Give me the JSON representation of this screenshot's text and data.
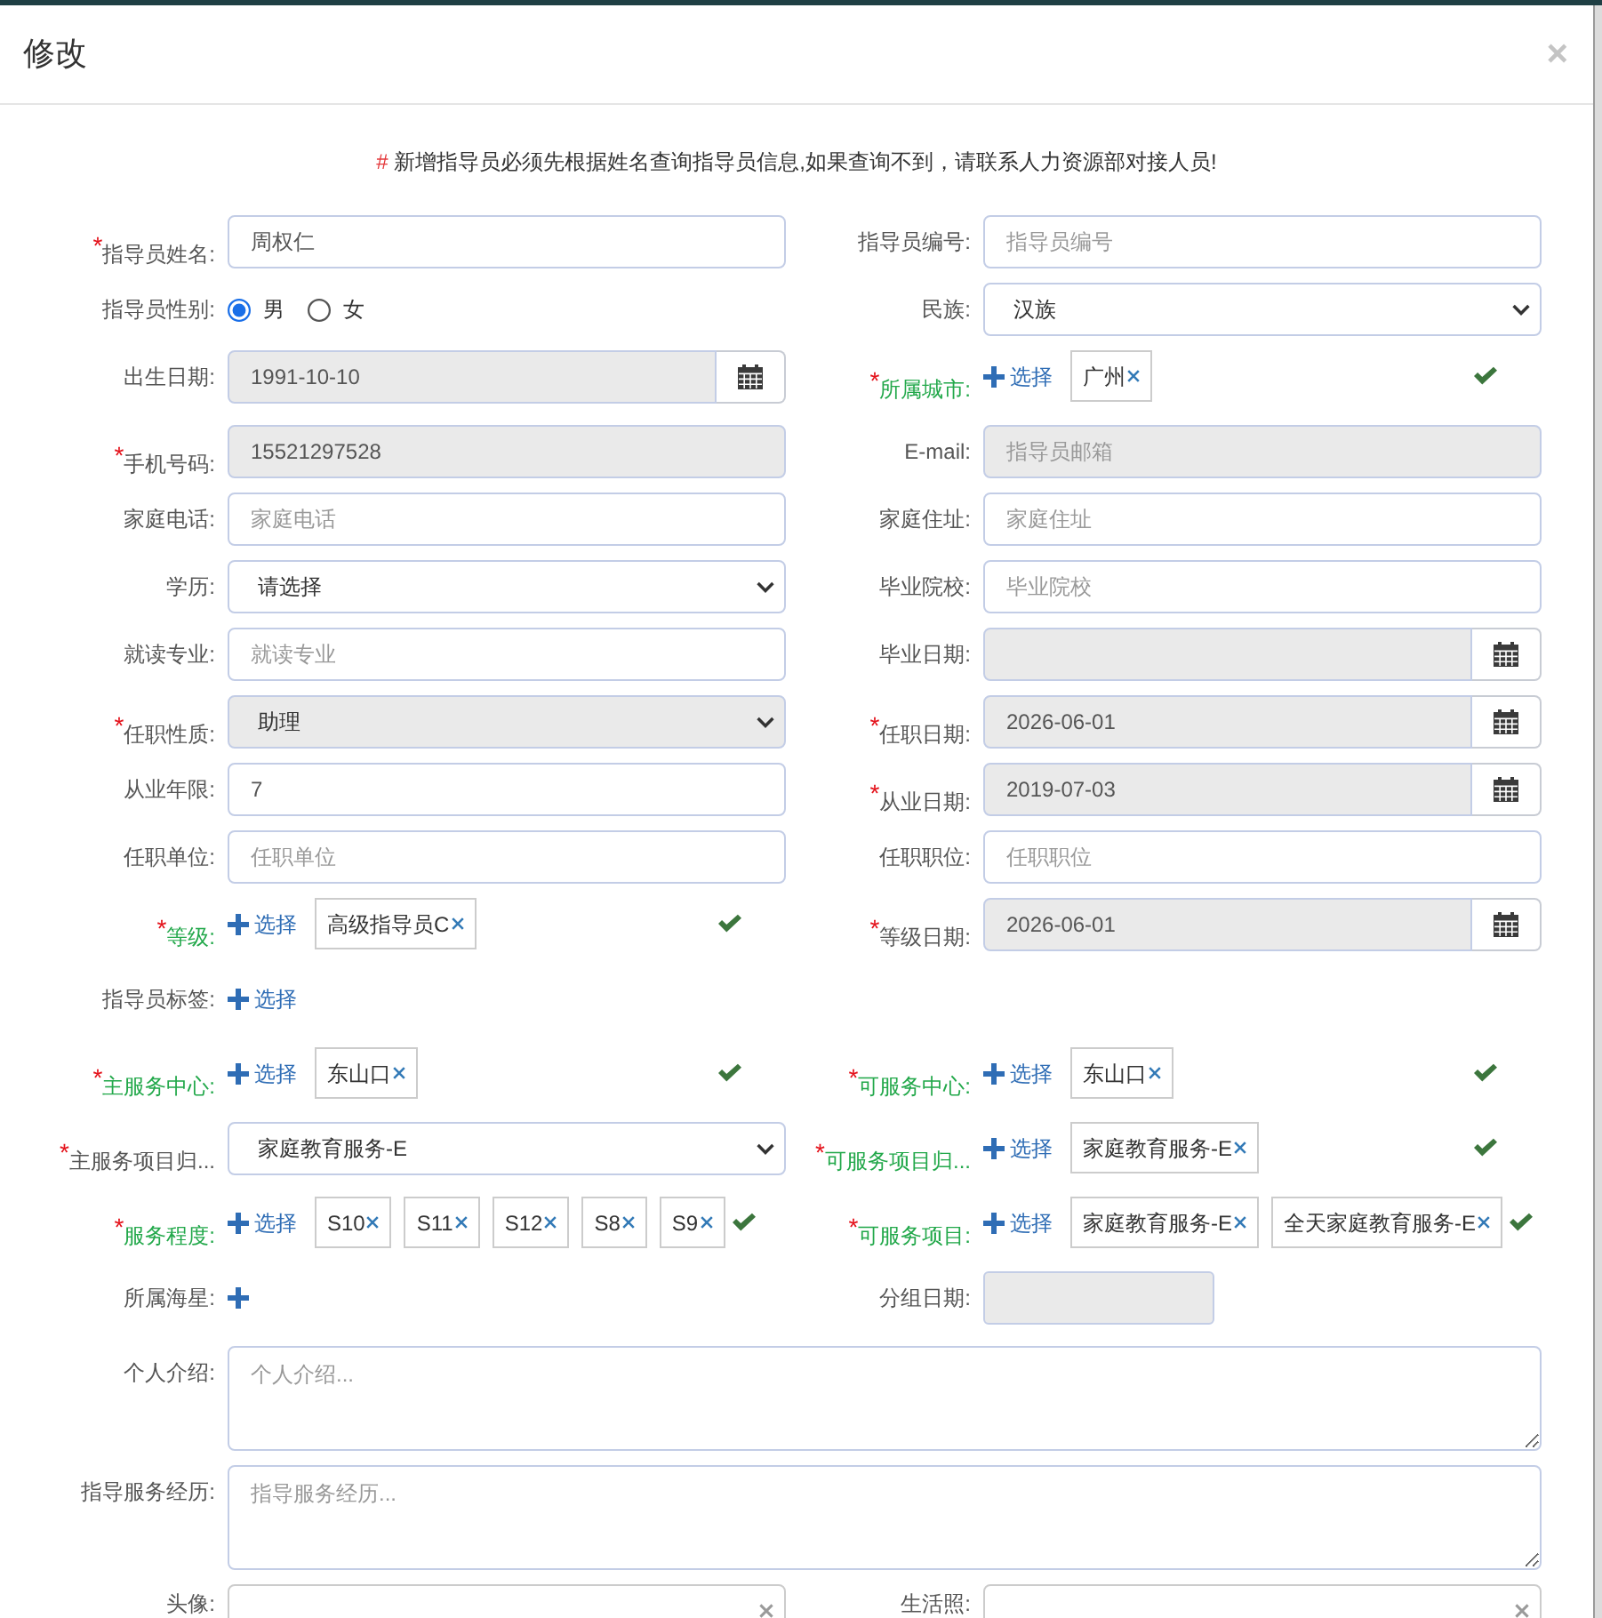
{
  "dialog": {
    "title": "修改",
    "close": "×"
  },
  "notice": "**#** 新增指导员必须先根据姓名查询指导员信息,如果查询不到，请联系人力资源部对接人员!",
  "rows": [
    {
      "left": {
        "kind": "text",
        "mark": "*",
        "label": "指导员姓名:",
        "value": "周权仁",
        "disabled": false
      },
      "right": {
        "kind": "text",
        "label": "指导员编号:",
        "placeholder": "指导员编号",
        "disabled": false
      }
    },
    {
      "left": {
        "kind": "radio",
        "label": "指导员性别:",
        "options": [
          {
            "label": "男",
            "selected": true
          },
          {
            "label": "女",
            "selected": false
          }
        ]
      },
      "right": {
        "kind": "select",
        "label": "民族:",
        "value": "汉族",
        "disabled": false
      }
    },
    {
      "left": {
        "kind": "date",
        "label": "出生日期:",
        "value": "1991-10-10",
        "disabled": true
      },
      "right": {
        "kind": "picker",
        "mark": "*",
        "label": "所属城市:",
        "action": "选择",
        "tags": [
          "广州"
        ],
        "valid": true
      }
    },
    {
      "left": {
        "kind": "text",
        "mark": "*",
        "label": "手机号码:",
        "value": "15521297528",
        "disabled": true
      },
      "right": {
        "kind": "text",
        "label": "E-mail:",
        "placeholder": "指导员邮箱",
        "disabled": true
      }
    },
    {
      "left": {
        "kind": "text",
        "label": "家庭电话:",
        "placeholder": "家庭电话",
        "disabled": false
      },
      "right": {
        "kind": "text",
        "label": "家庭住址:",
        "placeholder": "家庭住址",
        "disabled": false
      }
    },
    {
      "left": {
        "kind": "select",
        "label": "学历:",
        "value": "请选择",
        "disabled": false
      },
      "right": {
        "kind": "text",
        "label": "毕业院校:",
        "placeholder": "毕业院校",
        "disabled": false
      }
    },
    {
      "left": {
        "kind": "text",
        "label": "就读专业:",
        "placeholder": "就读专业",
        "disabled": false
      },
      "right": {
        "kind": "date",
        "label": "毕业日期:",
        "disabled": true
      }
    },
    {
      "left": {
        "kind": "select",
        "mark": "*",
        "label": "任职性质:",
        "value": "助理",
        "disabled": true
      },
      "right": {
        "kind": "date",
        "mark": "*",
        "label": "任职日期:",
        "value": "2026-06-01",
        "disabled": true
      }
    },
    {
      "left": {
        "kind": "text",
        "label": "从业年限:",
        "value": "7",
        "disabled": false
      },
      "right": {
        "kind": "date",
        "mark": "*",
        "label": "从业日期:",
        "value": "2019-07-03",
        "disabled": true
      }
    },
    {
      "left": {
        "kind": "text",
        "label": "任职单位:",
        "placeholder": "任职单位",
        "disabled": false
      },
      "right": {
        "kind": "text",
        "label": "任职职位:",
        "placeholder": "任职职位",
        "disabled": false
      }
    },
    {
      "left": {
        "kind": "picker",
        "mark": "*",
        "label": "等级:",
        "action": "选择",
        "tags": [
          "高级指导员C"
        ],
        "valid": true
      },
      "right": {
        "kind": "date",
        "mark": "*",
        "label": "等级日期:",
        "value": "2026-06-01",
        "disabled": true
      }
    },
    {
      "left": {
        "kind": "picker",
        "label": "指导员标签:",
        "action": "选择",
        "valid": false
      }
    },
    {
      "left": {
        "kind": "picker",
        "mark": "*",
        "label": "主服务中心:",
        "action": "选择",
        "tags": [
          "东山口"
        ],
        "valid": true
      },
      "right": {
        "kind": "picker",
        "mark": "*",
        "label": "可服务中心:",
        "action": "选择",
        "tags": [
          "东山口"
        ],
        "valid": true
      }
    },
    {
      "left": {
        "kind": "select",
        "mark": "*",
        "label": "主服务项目归...",
        "value": "家庭教育服务-E",
        "disabled": false
      },
      "right": {
        "kind": "picker",
        "mark": "*",
        "label": "可服务项目归...",
        "action": "选择",
        "tags": [
          "家庭教育服务-E"
        ],
        "valid": true
      }
    },
    {
      "left": {
        "kind": "picker",
        "mark": "*",
        "label": "服务程度:",
        "action": "选择",
        "tags": [
          "S10",
          "S11",
          "S12",
          "S8",
          "S9"
        ],
        "valid": true
      },
      "right": {
        "kind": "picker",
        "mark": "*",
        "label": "可服务项目:",
        "action": "选择",
        "tags": [
          "家庭教育服务-E",
          "全天家庭教育服务-E"
        ],
        "valid": true
      }
    },
    {
      "left": {
        "kind": "picker",
        "label": "所属海星:",
        "valid": false
      },
      "right": {
        "kind": "short-input",
        "label": "分组日期:",
        "disabled": true
      }
    },
    {
      "full": {
        "kind": "textarea",
        "label": "个人介绍:",
        "placeholder": "个人介绍..."
      }
    },
    {
      "full": {
        "kind": "textarea",
        "label": "指导服务经历:",
        "placeholder": "指导服务经历..."
      }
    },
    {
      "left": {
        "kind": "clearable-select",
        "label": "头像:"
      },
      "right": {
        "kind": "clearable-select",
        "label": "生活照:"
      }
    }
  ]
}
